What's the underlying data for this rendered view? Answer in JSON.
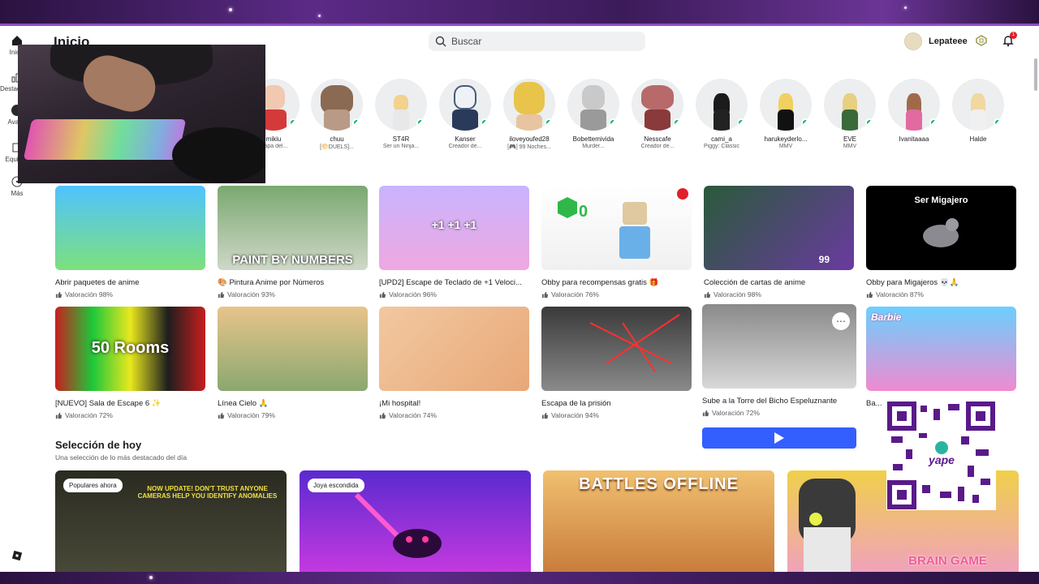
{
  "header": {
    "page_title": "Inicio",
    "search_placeholder": "Buscar",
    "username": "Lepateee",
    "notification_count": "1"
  },
  "leftnav": {
    "items": [
      {
        "label": "Inicio",
        "icon": "home-icon"
      },
      {
        "label": "Destacados",
        "icon": "charts-icon"
      },
      {
        "label": "Avatar",
        "icon": "avatar-icon"
      },
      {
        "label": "Equipos",
        "icon": "party-icon"
      },
      {
        "label": "Más",
        "icon": "more-icon"
      }
    ]
  },
  "friends": [
    {
      "name": "mikiu",
      "status": "...apa del...",
      "head": "#f0c9b0",
      "body": "#d43a3a"
    },
    {
      "name": "chuu",
      "status": "[🌕DUELS]...",
      "head": "#8a6a52",
      "body": "#b89a86"
    },
    {
      "name": "ST4R",
      "status": "Ser un Ninja...",
      "head": "#f2d28c",
      "body": "#e8e8e8"
    },
    {
      "name": "Kanser",
      "status": "Creador de...",
      "head": "#eef2f6",
      "body": "#2a3a5a"
    },
    {
      "name": "iloveyoufed28",
      "status": "[🎮] 99 Noches...",
      "head": "#e8c44a",
      "body": "#3a3a3a"
    },
    {
      "name": "Bobettemivida",
      "status": "Murder...",
      "head": "#c9c9c9",
      "body": "#9a9a9a"
    },
    {
      "name": "Nesscafe",
      "status": "Creador de...",
      "head": "#b86a6a",
      "body": "#8a3a3a"
    },
    {
      "name": "cami_a",
      "status": "Piggy: Classic",
      "head": "#1b1b1b",
      "body": "#222"
    },
    {
      "name": "harukeyderlo...",
      "status": "MMV",
      "head": "#f0d060",
      "body": "#111"
    },
    {
      "name": "EVE",
      "status": "MMV",
      "head": "#e8d080",
      "body": "#3a6a3a"
    },
    {
      "name": "Ivanitaaaa",
      "status": "",
      "head": "#a06a4a",
      "body": "#e26aa0"
    },
    {
      "name": "Halde",
      "status": "",
      "head": "#f0d8a0",
      "body": "#f0f0f0"
    }
  ],
  "games_row1": [
    {
      "title": "Abrir paquetes de anime",
      "rating": "Valoración 98%",
      "bg": "linear-gradient(180deg,#4fc3ff,#7de07d)",
      "label": ""
    },
    {
      "title": "🎨 Pintura Anime por Números",
      "rating": "Valoración 93%",
      "bg": "linear-gradient(180deg,#7aa870,#cfd8c8)",
      "label": "PAINT BY NUMBERS"
    },
    {
      "title": "[UPD2] Escape de Teclado de +1 Veloci...",
      "rating": "Valoración 96%",
      "bg": "linear-gradient(180deg,#c8b4ff,#f0a8e0)",
      "label": "+1  +1  +1"
    },
    {
      "title": "Obby para recompensas gratis 🎁",
      "rating": "Valoración 76%",
      "bg": "linear-gradient(180deg,#ffffff,#f0f0f0)",
      "label": ""
    },
    {
      "title": "Colección de cartas de anime",
      "rating": "Valoración 98%",
      "bg": "linear-gradient(135deg,#2a5a3a,#6a3aa0)",
      "label": "99"
    },
    {
      "title": "Obby para Migajeros 💀🙏",
      "rating": "Valoración 87%",
      "bg": "#000",
      "label": "Ser Migajero"
    }
  ],
  "games_row2": [
    {
      "title": "[NUEVO] Sala de Escape 6 ✨",
      "rating": "Valoración 72%",
      "bg": "linear-gradient(90deg,#c81e1e,#1ec83a,#e8e81e,#1e1e1e,#c81e1e)",
      "label": "50 Rooms"
    },
    {
      "title": "Línea Cielo 🙏",
      "rating": "Valoración 79%",
      "bg": "linear-gradient(180deg,#e8c48a,#8aa870)",
      "label": ""
    },
    {
      "title": "¡Mi hospital!",
      "rating": "Valoración 74%",
      "bg": "linear-gradient(135deg,#f2c8a0,#e8a878)",
      "label": ""
    },
    {
      "title": "Escapa de la prisión",
      "rating": "Valoración 94%",
      "bg": "linear-gradient(180deg,#3a3a3a,#8a8a8a)",
      "label": ""
    },
    {
      "title": "Sube a la Torre del Bicho Espeluznante",
      "rating": "Valoración 72%",
      "bg": "linear-gradient(180deg,#8a8a8a,#d8d8d8)",
      "label": ""
    },
    {
      "title": "Ba...",
      "rating": "",
      "bg": "linear-gradient(180deg,#6ad0ff,#f08ad0)",
      "label": "Barbie"
    }
  ],
  "section": {
    "title": "Selección de hoy",
    "subtitle": "Una selección de lo más destacado del día"
  },
  "featured": [
    {
      "pill": "Populares ahora",
      "bg": "linear-gradient(180deg,#2a2a20,#4a4a3a)",
      "label": "NOW UPDATE! DON'T TRUST ANYONE CAMERAS HELP YOU IDENTIFY ANOMALIES"
    },
    {
      "pill": "Joya escondida",
      "bg": "linear-gradient(180deg,#5a2ad0,#c83ae0)",
      "label": ""
    },
    {
      "pill": "",
      "bg": "linear-gradient(180deg,#f0c070,#c87a3a)",
      "label": "BATTLES OFFLINE"
    },
    {
      "pill": "",
      "bg": "linear-gradient(180deg,#f0d04a,#f0a0c0)",
      "label": "BRAIN GAME"
    }
  ],
  "qr": {
    "label": "yape"
  }
}
